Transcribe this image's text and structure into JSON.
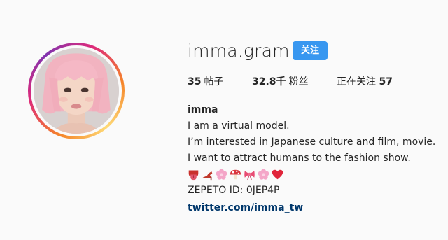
{
  "profile": {
    "username": "imma.gram",
    "follow_label": "关注",
    "avatar_icon": "profile-photo",
    "stats": {
      "posts_value": "35",
      "posts_label": "帖子",
      "followers_value": "32.8千",
      "followers_label": "粉丝",
      "following_label": "正在关注",
      "following_value": "57"
    },
    "bio": {
      "name": "imma",
      "line1": "I am a virtual model.",
      "line2": "I’m interested in Japanese culture and film, movie.",
      "line3": "I want to attract humans to the fashion show.",
      "emojis": [
        "tongue-emoji",
        "high-heel-emoji",
        "cherry-blossom-emoji",
        "mushroom-emoji",
        "ribbon-emoji",
        "cherry-blossom-emoji",
        "heart-emoji"
      ],
      "zepeto": "ZEPETO ID: 0JEP4P",
      "link": "twitter.com/imma_tw"
    }
  },
  "colors": {
    "accent": "#3897f0",
    "link": "#00376b",
    "background": "#fafafa",
    "text": "#262626"
  }
}
